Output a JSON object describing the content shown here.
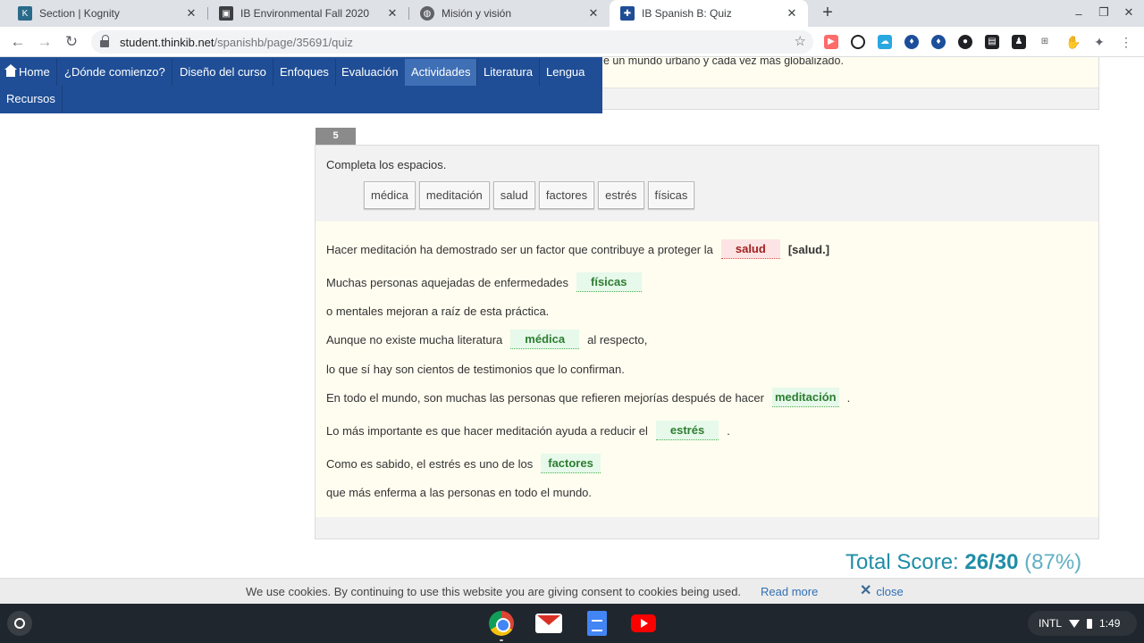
{
  "browser": {
    "tabs": [
      {
        "title": "Section | Kognity",
        "favicon": "kognity-icon",
        "active": false
      },
      {
        "title": "IB Environmental Fall 2020",
        "favicon": "thinkib-icon",
        "active": false
      },
      {
        "title": "Misión y visión",
        "favicon": "globe-icon",
        "active": false
      },
      {
        "title": "IB Spanish B: Quiz",
        "favicon": "thinkib-icon",
        "active": true
      }
    ],
    "url_host": "student.thinkib.net",
    "url_path": "/spanishb/page/35691/quiz"
  },
  "site_nav": {
    "items": [
      {
        "label": "Home",
        "icon": "home-icon"
      },
      {
        "label": "¿Dónde comienzo?"
      },
      {
        "label": "Diseño del curso"
      },
      {
        "label": "Enfoques"
      },
      {
        "label": "Evaluación"
      },
      {
        "label": "Actividades",
        "active": true
      },
      {
        "label": "Literatura"
      },
      {
        "label": "Lengua"
      },
      {
        "label": "Recursos"
      }
    ]
  },
  "previous_question": {
    "visible_text": "e un mundo urbano y cada vez más globalizado."
  },
  "question": {
    "number": "5",
    "instruction": "Completa los espacios.",
    "word_bank": [
      "médica",
      "meditación",
      "salud",
      "factores",
      "estrés",
      "físicas"
    ],
    "lines": [
      {
        "before": "Hacer meditación ha demostrado ser un factor que contribuye a proteger la",
        "answer": "salud",
        "status": "wrong",
        "correct": "[salud.]"
      },
      {
        "before": "Muchas personas aquejadas de enfermedades",
        "answer": "físicas",
        "status": "right"
      },
      {
        "before": "o mentales mejoran a raíz de esta práctica."
      },
      {
        "before": "Aunque no existe mucha literatura",
        "answer": "médica",
        "status": "right",
        "after": "al respecto,"
      },
      {
        "before": "lo que sí hay son cientos de testimonios que lo confirman."
      },
      {
        "before": "En todo el mundo, son muchas las personas que refieren mejorías después de hacer",
        "answer": "meditación",
        "status": "right",
        "after": "."
      },
      {
        "before": "Lo más importante es que hacer meditación ayuda a reducir el",
        "answer": "estrés",
        "status": "right",
        "after": "."
      },
      {
        "before": "Como es sabido, el estrés es uno de los",
        "answer": "factores",
        "status": "right"
      },
      {
        "before": "que más enferma a las personas en todo el mundo."
      }
    ]
  },
  "score": {
    "label": "Total Score:",
    "value": "26/30",
    "percent": "(87%)"
  },
  "cookie_bar": {
    "message": "We use cookies. By continuing to use this website you are giving consent to cookies being used.",
    "read_more": "Read more",
    "close": "close"
  },
  "shelf": {
    "apps": [
      "chrome-icon",
      "gmail-icon",
      "docs-icon",
      "youtube-icon"
    ],
    "status": {
      "input": "INTL",
      "time": "1:49"
    }
  },
  "colors": {
    "nav_bg": "#1f4e96",
    "nav_active": "#3f6fb5",
    "answer_right": "#2e7d32",
    "answer_wrong": "#a32020",
    "score": "#1f8ea6"
  }
}
